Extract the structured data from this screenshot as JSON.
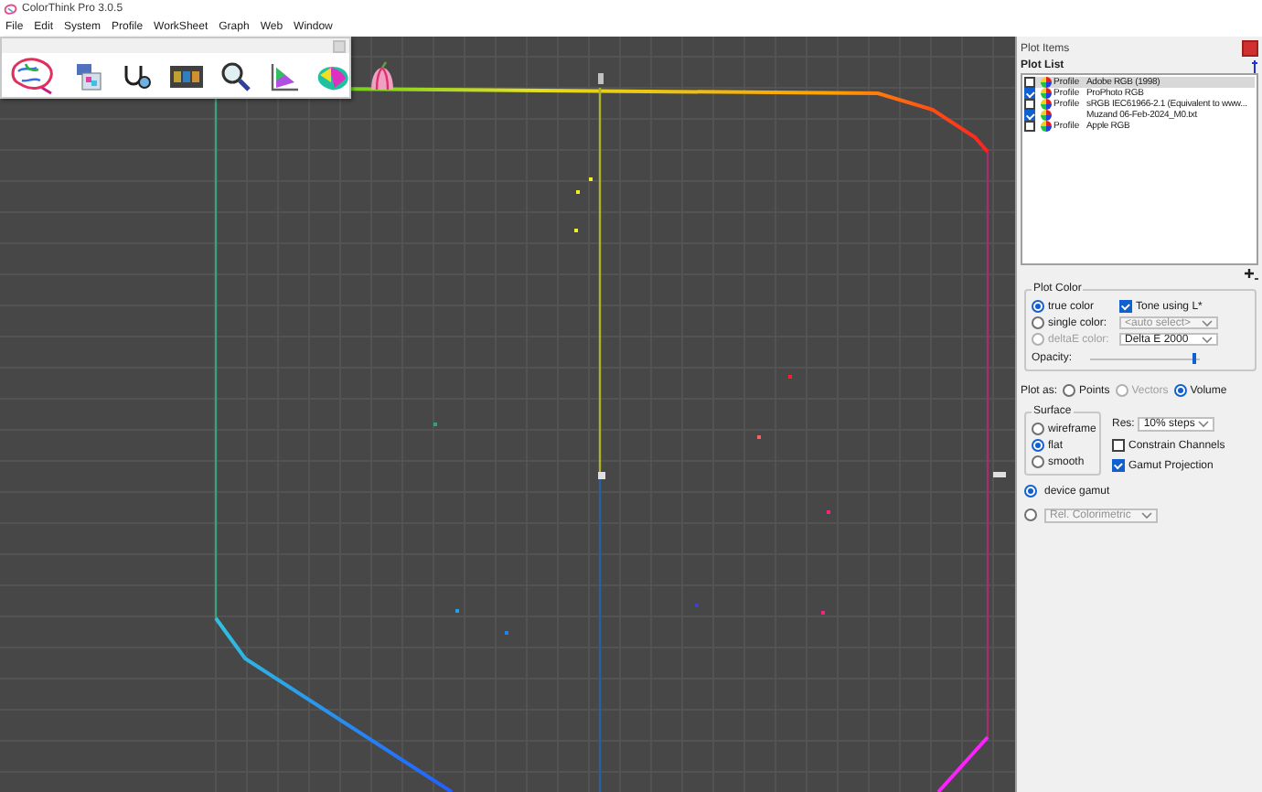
{
  "window": {
    "title": "ColorThink Pro 3.0.5"
  },
  "menu": [
    "File",
    "Edit",
    "System",
    "Profile",
    "WorkSheet",
    "Graph",
    "Web",
    "Window"
  ],
  "plot_items": {
    "title": "Plot Items",
    "list_title": "Plot List",
    "items": [
      {
        "checked": false,
        "selected": true,
        "type": "Profile",
        "name": "Adobe RGB (1998)"
      },
      {
        "checked": true,
        "selected": false,
        "type": "Profile",
        "name": "ProPhoto RGB"
      },
      {
        "checked": false,
        "selected": false,
        "type": "Profile",
        "name": "sRGB IEC61966-2.1 (Equivalent to www..."
      },
      {
        "checked": true,
        "selected": false,
        "name": "Muzand 06-Feb-2024_M0.txt"
      },
      {
        "checked": false,
        "selected": false,
        "type": "Profile",
        "name": "Apple RGB"
      }
    ]
  },
  "plot_color": {
    "title": "Plot Color",
    "modes": [
      {
        "label": "true color",
        "selected": true,
        "disabled": false
      },
      {
        "label": "single color:",
        "selected": false,
        "disabled": false
      },
      {
        "label": "deltaE color:",
        "selected": false,
        "disabled": true
      }
    ],
    "tone": {
      "label": "Tone using L*",
      "checked": true
    },
    "single_color_select": {
      "value": "<auto select>",
      "disabled": true
    },
    "delta_select": {
      "value": "Delta E 2000",
      "disabled": false
    },
    "opacity": {
      "label": "Opacity:",
      "level": 0.95
    }
  },
  "plot_as": {
    "label": "Plot as:",
    "options": [
      {
        "label": "Points",
        "selected": false,
        "disabled": false
      },
      {
        "label": "Vectors",
        "selected": false,
        "disabled": true
      },
      {
        "label": "Volume",
        "selected": true,
        "disabled": false
      }
    ]
  },
  "surface": {
    "title": "Surface",
    "options": [
      {
        "label": "wireframe",
        "selected": false
      },
      {
        "label": "flat",
        "selected": true
      },
      {
        "label": "smooth",
        "selected": false
      }
    ]
  },
  "res": {
    "label": "Res:",
    "value": "10% steps"
  },
  "constrain_channels": {
    "label": "Constrain Channels",
    "checked": false
  },
  "gamut_projection": {
    "label": "Gamut Projection",
    "checked": true
  },
  "gamut_source": [
    {
      "kind": "label",
      "label": "device gamut",
      "selected": true
    },
    {
      "kind": "select",
      "value": "Rel. Colorimetric",
      "selected": false,
      "disabled": true
    }
  ]
}
